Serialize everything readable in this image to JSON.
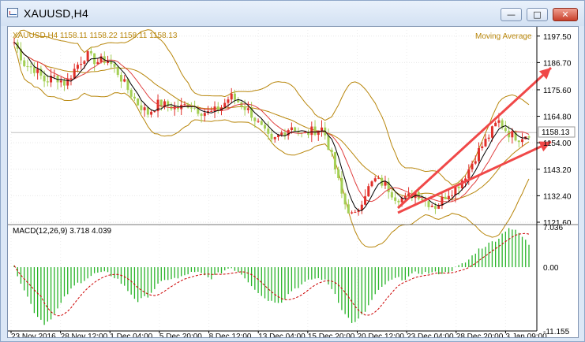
{
  "window": {
    "title": "XAUUSD,H4",
    "controls": {
      "minimize": "—",
      "maximize": "□",
      "close": "✕"
    }
  },
  "chart_data": {
    "type": "candlestick",
    "info_label": "XAUUSD,H4 1158.11 1158.22 1158.11 1158.13",
    "indicator_label": "Moving Average",
    "price_axis": {
      "ticks": [
        "1197.50",
        "1186.70",
        "1175.60",
        "1164.80",
        "1154.00",
        "1143.20",
        "1132.40",
        "1121.60"
      ],
      "ylim": [
        1121.6,
        1200.0
      ],
      "current_price": "1158.13"
    },
    "time_axis": {
      "labels": [
        "23 Nov 2016",
        "28 Nov 12:00",
        "1 Dec 04:00",
        "5 Dec 20:00",
        "8 Dec 12:00",
        "13 Dec 04:00",
        "15 Dec 20:00",
        "20 Dec 12:00",
        "23 Dec 04:00",
        "28 Dec 20:00",
        "3 Jan 09:00"
      ]
    },
    "close_path": [
      1195,
      1186,
      1184,
      1179,
      1181,
      1178,
      1185,
      1190,
      1187,
      1188,
      1183,
      1176,
      1170,
      1166,
      1170,
      1169,
      1168,
      1170,
      1167,
      1166,
      1168,
      1173,
      1170,
      1166,
      1160,
      1154,
      1158,
      1161,
      1157,
      1159,
      1160,
      1146,
      1130,
      1123,
      1133,
      1139,
      1137,
      1132,
      1131,
      1134,
      1130,
      1128,
      1133,
      1136,
      1142,
      1150,
      1156,
      1163,
      1158,
      1156,
      1158
    ],
    "macd": {
      "label": "MACD(12,26,9) 3.718 4.039",
      "ticks": [
        "7.036",
        "0.00",
        "-11.155"
      ],
      "ylim": [
        -11.155,
        7.036
      ],
      "histogram_color": "#28b428",
      "signal_color": "#cc0000",
      "hist_path": [
        0,
        -4,
        -8,
        -10,
        -8,
        -5,
        -3,
        -2,
        -1,
        -1,
        -2,
        -4,
        -6,
        -5,
        -3,
        -2,
        -2,
        -1,
        -1,
        -2,
        -1,
        0,
        -1,
        -3,
        -5,
        -6,
        -6,
        -4,
        -3,
        -2,
        -2,
        -4,
        -8,
        -10,
        -8,
        -5,
        -3,
        -2,
        -2,
        -1,
        -1,
        -1,
        -1,
        0,
        1,
        3,
        4,
        5,
        7,
        6,
        4
      ]
    },
    "colors": {
      "bull": "#e0302a",
      "bear": "#a4cf55",
      "bands": "#b8860b",
      "ma_fast": "#000000",
      "ma_slow": "#e04040",
      "arrows": "#f04848"
    },
    "grid": true
  }
}
